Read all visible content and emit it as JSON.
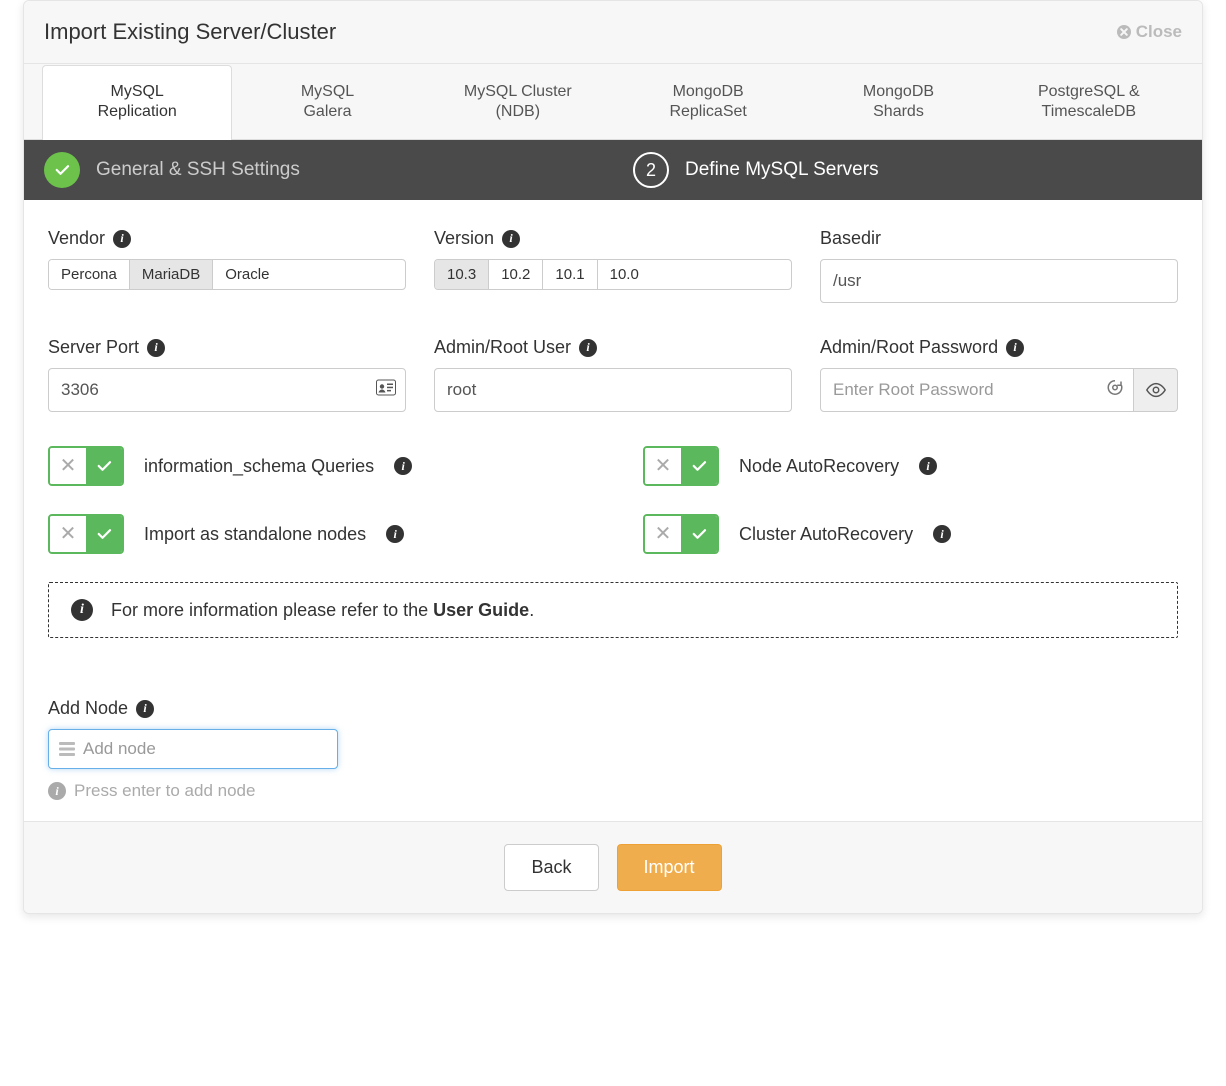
{
  "header": {
    "title": "Import Existing Server/Cluster",
    "close_label": "Close"
  },
  "tabs": [
    {
      "line1": "MySQL",
      "line2": "Replication"
    },
    {
      "line1": "MySQL",
      "line2": "Galera"
    },
    {
      "line1": "MySQL Cluster",
      "line2": "(NDB)"
    },
    {
      "line1": "MongoDB",
      "line2": "ReplicaSet"
    },
    {
      "line1": "MongoDB",
      "line2": "Shards"
    },
    {
      "line1": "PostgreSQL &",
      "line2": "TimescaleDB"
    }
  ],
  "steps": {
    "one_label": "General & SSH Settings",
    "two_number": "2",
    "two_label": "Define MySQL Servers"
  },
  "form": {
    "vendor_label": "Vendor",
    "vendors": [
      "Percona",
      "MariaDB",
      "Oracle"
    ],
    "version_label": "Version",
    "versions": [
      "10.3",
      "10.2",
      "10.1",
      "10.0"
    ],
    "basedir_label": "Basedir",
    "basedir_value": "/usr",
    "port_label": "Server Port",
    "port_value": "3306",
    "admin_user_label": "Admin/Root User",
    "admin_user_value": "root",
    "admin_pass_label": "Admin/Root Password",
    "admin_pass_placeholder": "Enter Root Password"
  },
  "toggles": {
    "info_schema": "information_schema Queries",
    "node_auto": "Node AutoRecovery",
    "standalone": "Import as standalone nodes",
    "cluster_auto": "Cluster AutoRecovery"
  },
  "hint": {
    "prefix": "For more information please refer to the ",
    "link": "User Guide",
    "suffix": "."
  },
  "addnode": {
    "label": "Add Node",
    "placeholder": "Add node",
    "helper": "Press enter to add node"
  },
  "footer": {
    "back": "Back",
    "import": "Import"
  }
}
